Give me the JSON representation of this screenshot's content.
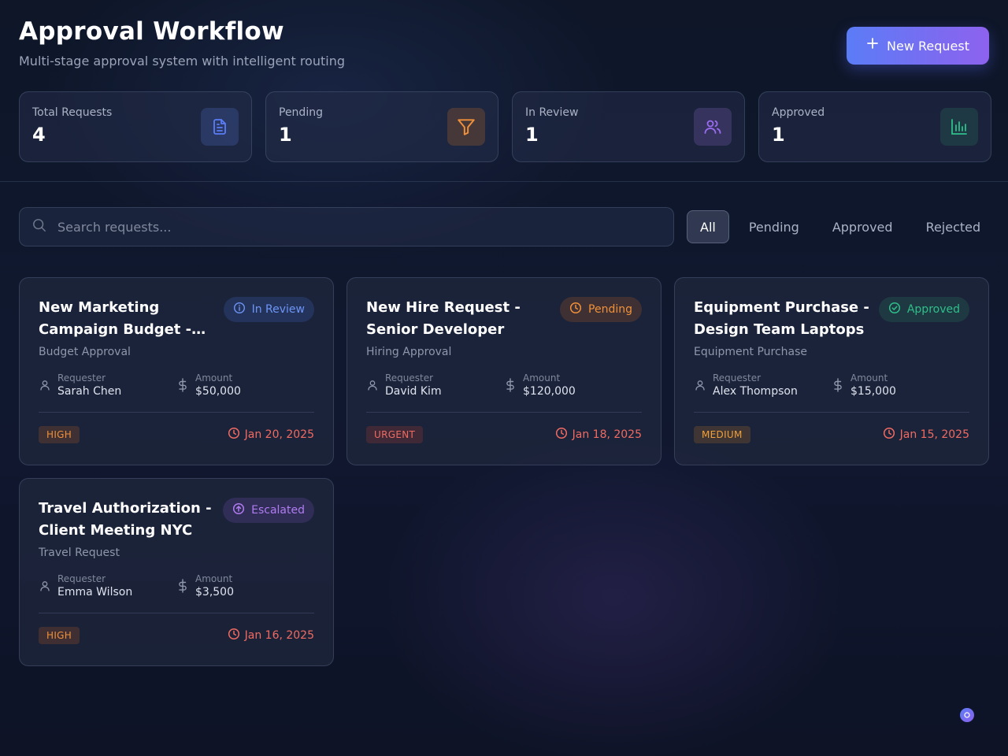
{
  "header": {
    "title": "Approval Workflow",
    "subtitle": "Multi-stage approval system with intelligent routing",
    "new_request_label": "New Request"
  },
  "stats": [
    {
      "label": "Total Requests",
      "value": "4",
      "icon": "document-icon",
      "color": "#5b7cf6"
    },
    {
      "label": "Pending",
      "value": "1",
      "icon": "filter-icon",
      "color": "#f0913a"
    },
    {
      "label": "In Review",
      "value": "1",
      "icon": "users-icon",
      "color": "#9b6cf2"
    },
    {
      "label": "Approved",
      "value": "1",
      "icon": "bar-chart-icon",
      "color": "#2fbf8a"
    }
  ],
  "search": {
    "placeholder": "Search requests..."
  },
  "filters": [
    "All",
    "Pending",
    "Approved",
    "Rejected"
  ],
  "active_filter": "All",
  "labels": {
    "requester": "Requester",
    "amount": "Amount"
  },
  "requests": [
    {
      "title": "New Marketing Campaign Budget - Q...",
      "category": "Budget Approval",
      "status": "In Review",
      "status_icon": "info-icon",
      "status_color": "#5b8cf6",
      "requester": "Sarah Chen",
      "amount": "$50,000",
      "priority": "HIGH",
      "priority_color": "#f0913a",
      "date": "Jan 20, 2025"
    },
    {
      "title": "New Hire Request - Senior Developer",
      "category": "Hiring Approval",
      "status": "Pending",
      "status_icon": "clock-icon",
      "status_color": "#f0913a",
      "requester": "David Kim",
      "amount": "$120,000",
      "priority": "URGENT",
      "priority_color": "#ef6b62",
      "date": "Jan 18, 2025"
    },
    {
      "title": "Equipment Purchase - Design Team Laptops",
      "category": "Equipment Purchase",
      "status": "Approved",
      "status_icon": "check-circle-icon",
      "status_color": "#2fbf8a",
      "requester": "Alex Thompson",
      "amount": "$15,000",
      "priority": "MEDIUM",
      "priority_color": "#f0a03a",
      "date": "Jan 15, 2025"
    },
    {
      "title": "Travel Authorization - Client Meeting NYC",
      "category": "Travel Request",
      "status": "Escalated",
      "status_icon": "arrow-up-circle-icon",
      "status_color": "#b07cf0",
      "requester": "Emma Wilson",
      "amount": "$3,500",
      "priority": "HIGH",
      "priority_color": "#f0913a",
      "date": "Jan 16, 2025"
    }
  ]
}
